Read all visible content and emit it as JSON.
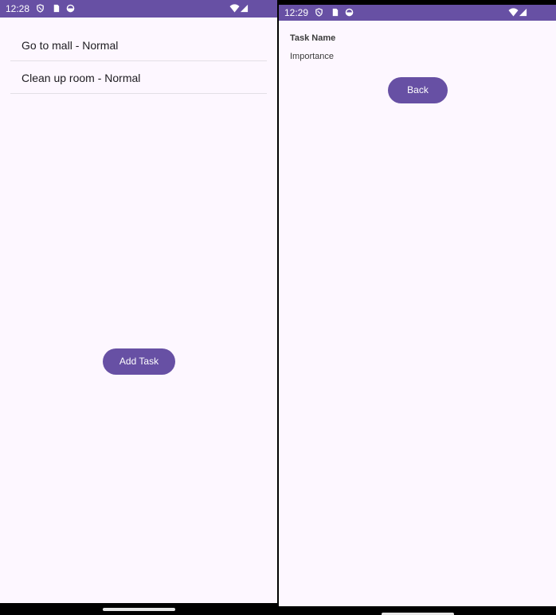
{
  "left_screen": {
    "status_time": "12:28",
    "tasks": [
      {
        "label": "Go to mall - Normal"
      },
      {
        "label": "Clean up room - Normal"
      }
    ],
    "add_task_label": "Add Task"
  },
  "right_screen": {
    "status_time": "12:29",
    "task_name_label": "Task Name",
    "importance_label": "Importance",
    "back_label": "Back"
  },
  "colors": {
    "primary": "#6750a4",
    "background": "#fdf7ff",
    "divider": "#e3dfe6"
  },
  "icons": [
    "shield-icon",
    "sim-card-icon",
    "circle-status-icon",
    "wifi-icon",
    "cellular-signal-icon"
  ]
}
